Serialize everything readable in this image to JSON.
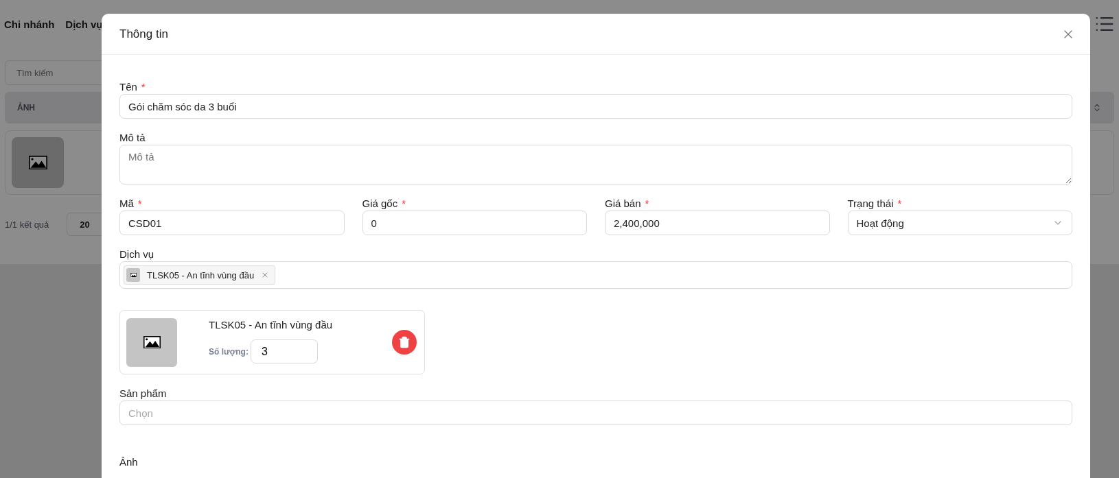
{
  "background": {
    "nav": [
      {
        "label": "Chi nhánh"
      },
      {
        "label": "Dịch vụ"
      }
    ],
    "search": {
      "placeholder": "Tìm kiếm"
    },
    "table": {
      "columns": [
        "ẢNH"
      ]
    },
    "pagination": {
      "summary": "1/1 kết quả",
      "page_size": "20"
    }
  },
  "modal": {
    "title": "Thông tin",
    "fields": [
      {
        "kind": "text",
        "label": "Tên",
        "required_mark": "*",
        "value": "Gói chăm sóc da 3 buổi"
      },
      {
        "kind": "textarea",
        "label": "Mô tả",
        "placeholder": "Mô tả"
      },
      {
        "kind": "row",
        "fields": [
          {
            "kind": "text",
            "label": "Mã",
            "required_mark": "*",
            "value": "CSD01"
          },
          {
            "kind": "text",
            "label": "Giá gốc",
            "required_mark": "*",
            "value": "0"
          },
          {
            "kind": "text",
            "label": "Giá bán",
            "required_mark": "*",
            "value": "2,400,000"
          },
          {
            "kind": "select",
            "label": "Trạng thái",
            "required_mark": "*",
            "value": "Hoạt động"
          }
        ]
      },
      {
        "kind": "tags",
        "label": "Dịch vụ",
        "tags": [
          {
            "label": "TLSK05 - An tĩnh vùng đầu"
          }
        ]
      },
      {
        "kind": "items",
        "items": [
          {
            "name": "TLSK05 - An tĩnh vùng đầu",
            "quantity_label": "Số lượng:",
            "quantity": "3"
          }
        ]
      },
      {
        "kind": "select",
        "label": "Sản phẩm",
        "placeholder": "Chọn"
      },
      {
        "kind": "label",
        "label": "Ảnh"
      }
    ]
  }
}
